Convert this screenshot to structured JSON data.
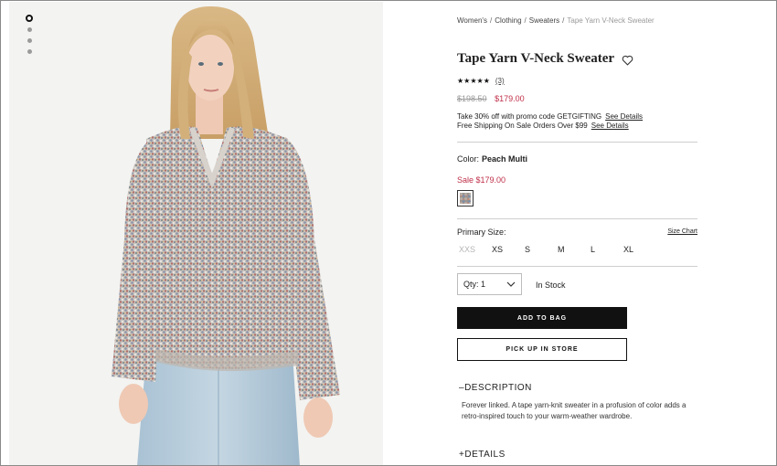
{
  "breadcrumb": [
    "Women's",
    "Clothing",
    "Sweaters",
    "Tape Yarn V-Neck Sweater"
  ],
  "breadcrumb_separator": "/",
  "gallery": {
    "image_count": 4,
    "active_index": 0
  },
  "product": {
    "title": "Tape Yarn V-Neck Sweater",
    "rating_stars": "★★★★★",
    "rating_value": 5,
    "review_count": "(3)",
    "original_price": "$198.50",
    "sale_price": "$179.00"
  },
  "promo": {
    "line1": "Take 30% off with promo code GETGIFTING",
    "line2": "Free Shipping On Sale Orders Over $99",
    "details_link": "See Details"
  },
  "color": {
    "label": "Color:",
    "value": "Peach Multi",
    "sale_text": "Sale $179.00"
  },
  "size": {
    "label": "Primary Size:",
    "chart_link": "Size Chart",
    "options": [
      {
        "label": "XXS",
        "available": false
      },
      {
        "label": "XS",
        "available": true
      },
      {
        "label": "S",
        "available": true
      },
      {
        "label": "M",
        "available": true
      },
      {
        "label": "L",
        "available": true
      },
      {
        "label": "XL",
        "available": true
      }
    ]
  },
  "quantity": {
    "label": "Qty: 1"
  },
  "stock_status": "In Stock",
  "buttons": {
    "add_to_bag": "ADD TO BAG",
    "pick_up": "PICK UP IN STORE"
  },
  "description": {
    "header": "DESCRIPTION",
    "toggle": "–",
    "text": "Forever linked. A tape yarn-knit sweater in a profusion of color adds a retro-inspired touch to your warm-weather wardrobe."
  },
  "details": {
    "header": "DETAILS",
    "toggle": "+"
  },
  "colors": {
    "sale": "#c0304a",
    "button": "#111111"
  }
}
